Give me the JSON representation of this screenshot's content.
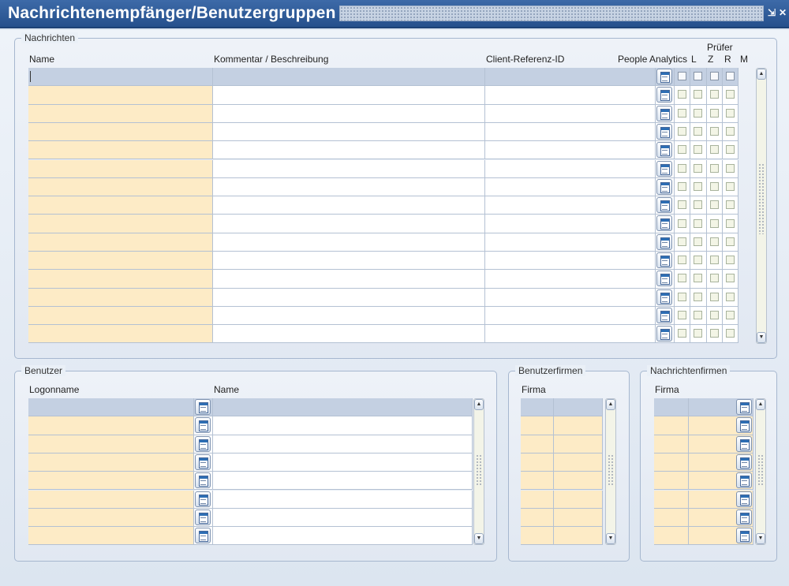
{
  "window": {
    "title": "Nachrichtenempfänger/Benutzergruppen",
    "minimize_icon": "minimize-icon",
    "close_icon": "close-icon",
    "minimize_glyph": "⇲",
    "close_glyph": "✕"
  },
  "nachrichten": {
    "legend": "Nachrichten",
    "columns": {
      "name": "Name",
      "kommentar": "Kommentar / Beschreibung",
      "client_ref": "Client-Referenz-ID",
      "people_analytics": "People Analytics",
      "pruefer": "Prüfer",
      "l": "L",
      "z": "Z",
      "r": "R",
      "m": "M"
    },
    "row_count": 15,
    "rows": []
  },
  "benutzer": {
    "legend": "Benutzer",
    "columns": {
      "logonname": "Logonname",
      "name": "Name"
    },
    "row_count": 8,
    "rows": []
  },
  "benutzerfirmen": {
    "legend": "Benutzerfirmen",
    "columns": {
      "firma": "Firma"
    },
    "row_count": 8,
    "rows": []
  },
  "nachrichtenfirmen": {
    "legend": "Nachrichtenfirmen",
    "columns": {
      "firma": "Firma"
    },
    "row_count": 8,
    "rows": []
  },
  "colors": {
    "title_bar": "#2f5d9b",
    "editable_cell": "#fdebc6",
    "selected_row": "#c4d0e2",
    "background": "#dce5f0"
  }
}
